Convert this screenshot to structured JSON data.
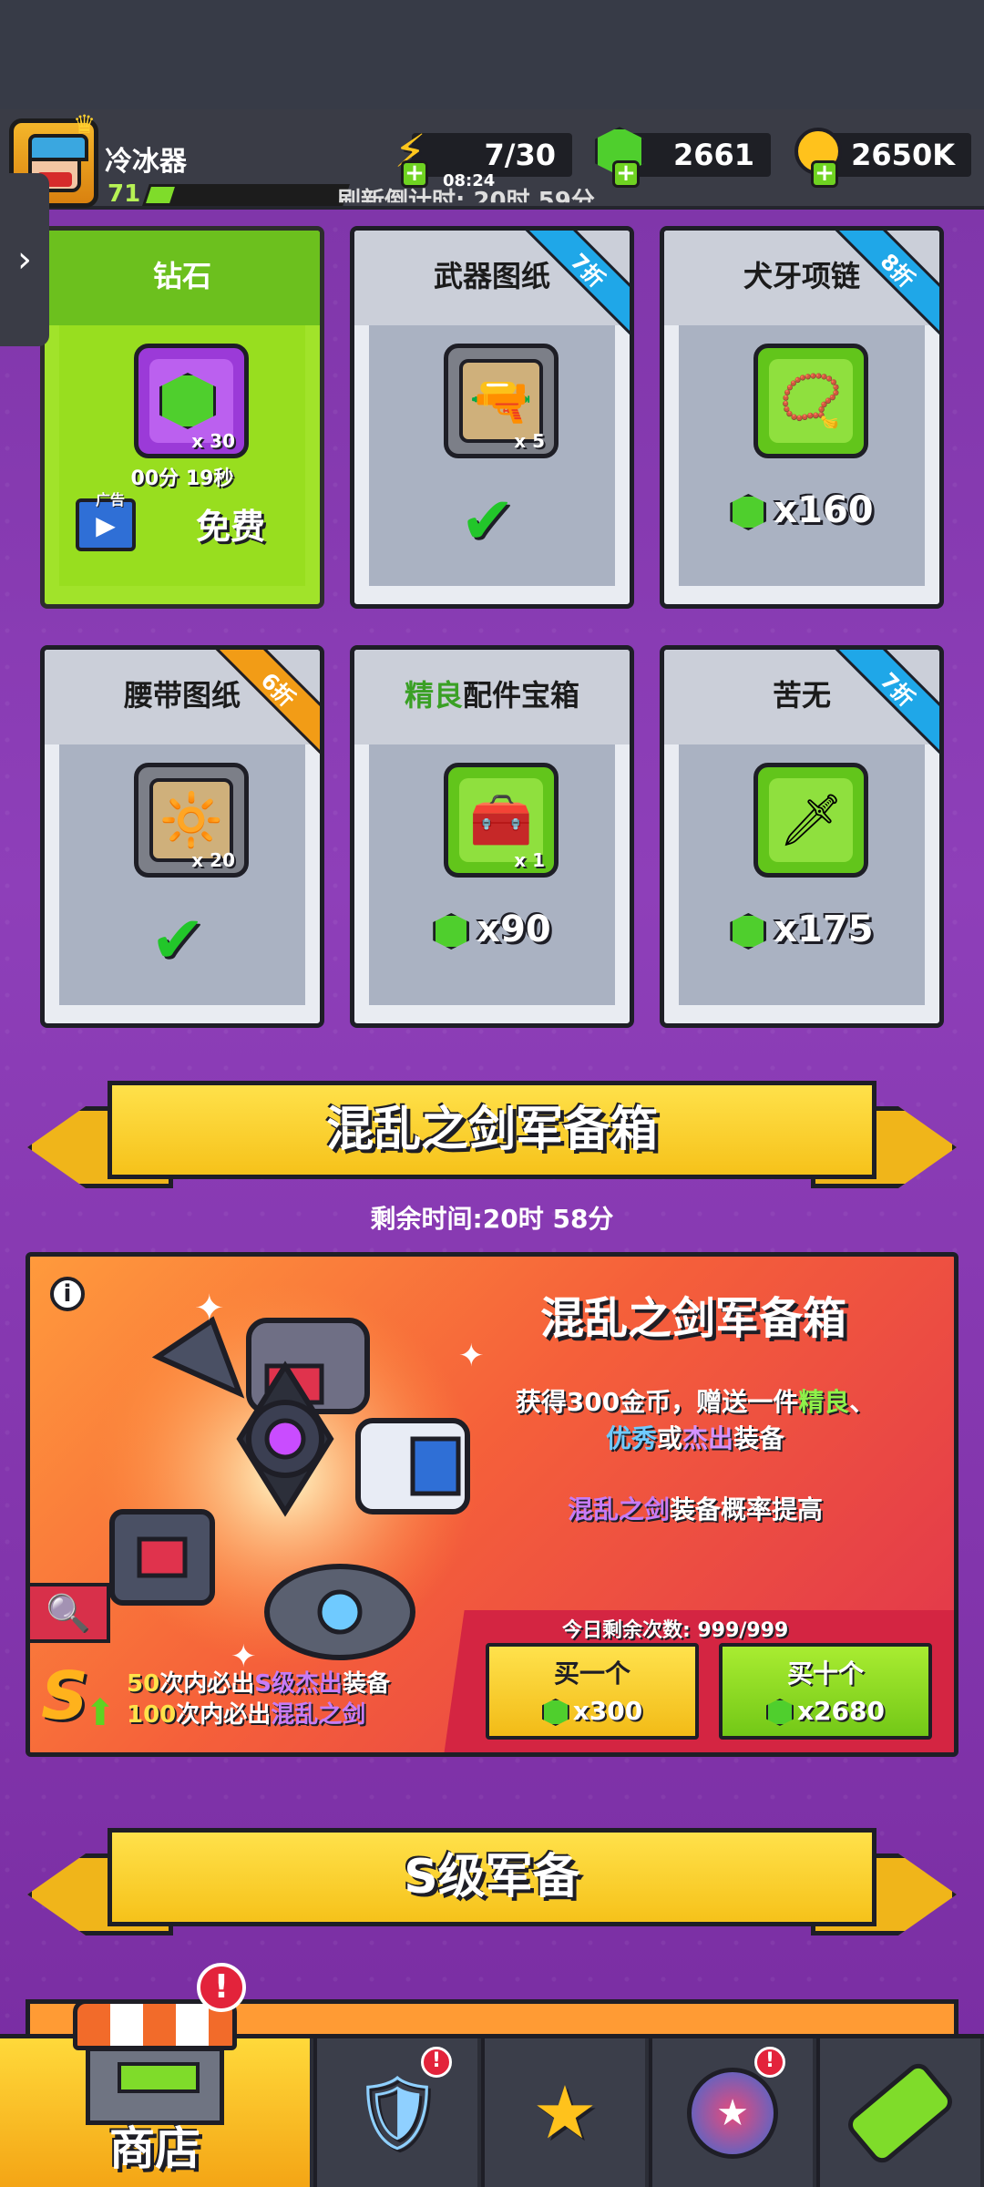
{
  "topbar": {
    "player_name": "冷冰器",
    "level": "71",
    "xp_fraction": 0.12,
    "energy": "7/30",
    "energy_timer": "08:24",
    "gems": "2661",
    "coins": "2650K",
    "refresh_countdown": "刷新倒计时: 20时 59分"
  },
  "shop_cards": [
    {
      "title": "钻石",
      "qty": "x 30",
      "timer": "00分 19秒",
      "ad_label": "广告",
      "free_label": "免费",
      "icon": "gem-icon"
    },
    {
      "title": "武器图纸",
      "qty": "x 5",
      "discount": "7折",
      "state": "purchased",
      "icon": "scroll-icon"
    },
    {
      "title": "犬牙项链",
      "price": "x160",
      "discount": "8折",
      "icon": "necklace-icon"
    },
    {
      "title": "腰带图纸",
      "qty": "x 20",
      "discount": "6折",
      "state": "purchased",
      "icon": "belt-scroll-icon"
    },
    {
      "title_highlight": "精良",
      "title_rest": "配件宝箱",
      "qty": "x 1",
      "price": "x90",
      "icon": "chest-icon"
    },
    {
      "title": "苦无",
      "price": "x175",
      "discount": "7折",
      "icon": "kunai-icon"
    }
  ],
  "section1": {
    "banner": "混乱之剑军备箱",
    "remaining": "剩余时间:20时 58分"
  },
  "bigbox": {
    "title": "混乱之剑军备箱",
    "desc_1": "获得300金币，赠送一件",
    "desc_green": "精良",
    "desc_2": "、",
    "desc_blue": "优秀",
    "desc_or": "或",
    "desc_purple": "杰出",
    "desc_3": "装备",
    "note_highlight": "混乱之剑",
    "note_rest": "装备概率提高",
    "guarantee_1_num": "50",
    "guarantee_1_mid": "次内必出",
    "guarantee_1_hl": "S级杰出",
    "guarantee_1_end": "装备",
    "guarantee_2_num": "100",
    "guarantee_2_mid": "次内必出",
    "guarantee_2_hl": "混乱之剑",
    "today_left": "今日剩余次数: 999/999",
    "buy_one_label": "买一个",
    "buy_one_price": "x300",
    "buy_ten_label": "买十个",
    "buy_ten_price": "x2680"
  },
  "section2": {
    "banner": "S级军备"
  },
  "bottom_nav": {
    "shop_label": "商店",
    "alert": "!"
  },
  "colors": {
    "background": "#7e35a8",
    "accent_yellow": "#f6c21a",
    "gem_green": "#4fcf2d",
    "discount_blue": "#1fa7e8",
    "discount_orange": "#f29c16"
  }
}
